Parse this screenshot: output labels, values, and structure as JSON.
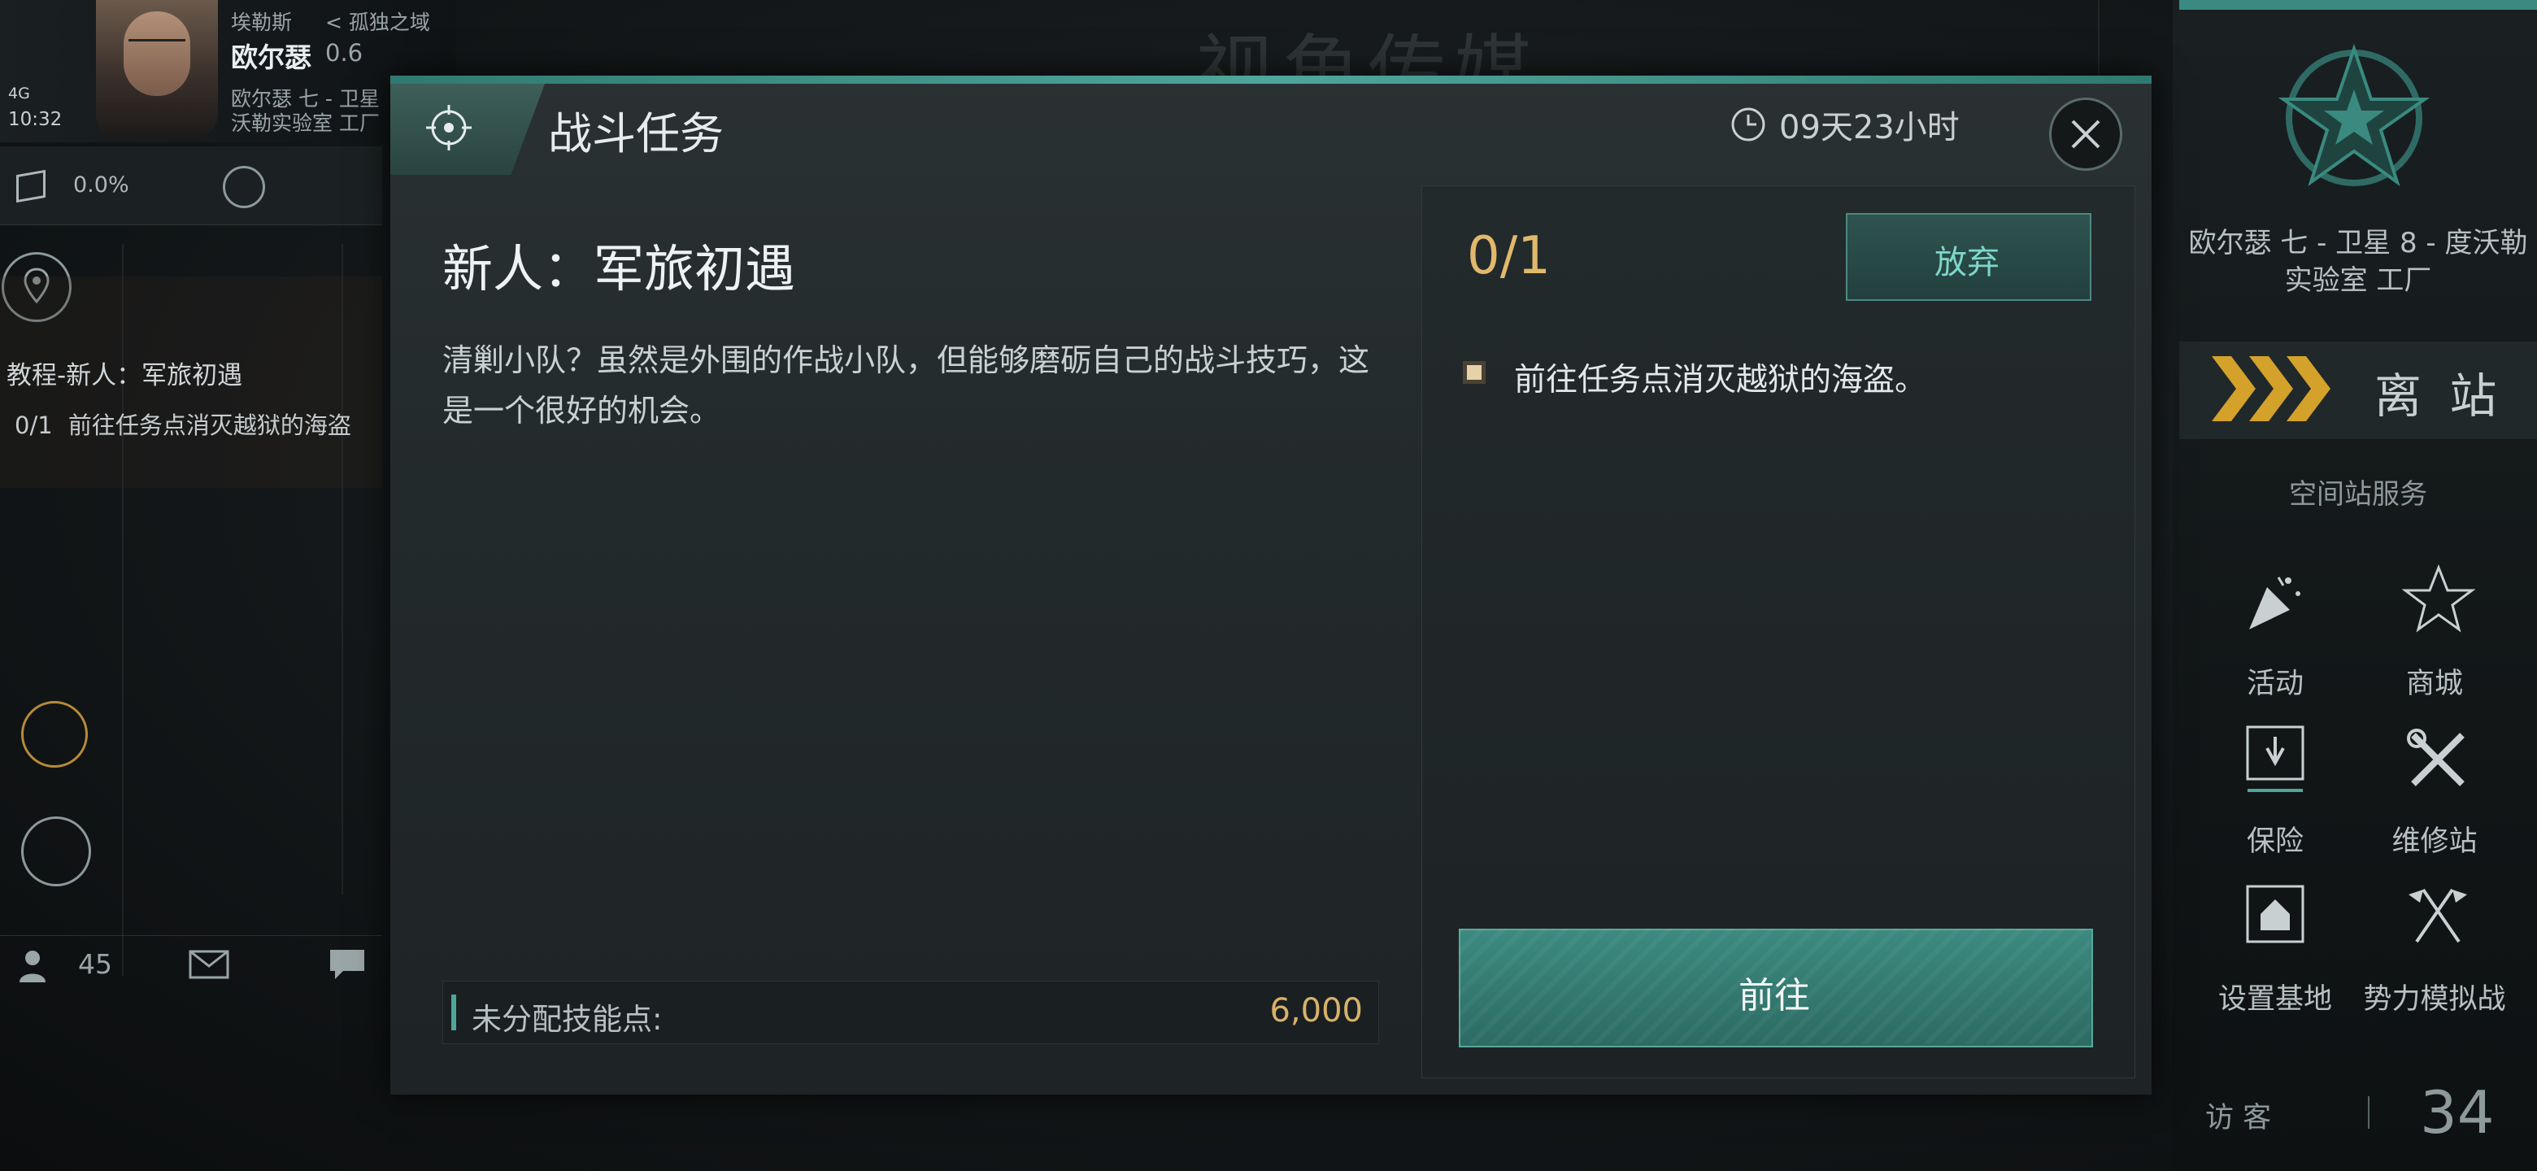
{
  "hud": {
    "region": "埃勒斯",
    "area": "< 孤独之域",
    "system": "欧尔瑟",
    "security": "0.6",
    "station_line1": "欧尔瑟 七 - 卫星",
    "station_line2": "沃勒实验室 工厂",
    "network": "4G",
    "time": "10:32",
    "cargo_pct": "0.0%",
    "tutorial_title": "教程-新人：军旅初遇",
    "tutorial_progress": "0/1",
    "tutorial_task": "前往任务点消灭越狱的海盗",
    "online_count": "45"
  },
  "background": {
    "title": "视角传媒"
  },
  "right_panel": {
    "location": "欧尔瑟 七 - 卫星 8 - 度沃勒实验室 工厂",
    "depart_label": "离 站",
    "services_title": "空间站服务",
    "services": [
      {
        "label": "活动",
        "icon": "party-popper-icon"
      },
      {
        "label": "商城",
        "icon": "shop-star-icon"
      },
      {
        "label": "保险",
        "icon": "insurance-shield-icon"
      },
      {
        "label": "维修站",
        "icon": "repair-tools-icon"
      },
      {
        "label": "设置基地",
        "icon": "base-icon"
      },
      {
        "label": "势力模拟战",
        "icon": "crossed-flags-icon"
      }
    ],
    "visitor_label": "访 客",
    "visitor_count": "34"
  },
  "modal": {
    "title": "战斗任务",
    "timer": "09天23小时",
    "mission_name": "新人：军旅初遇",
    "description": "清剿小队？虽然是外围的作战小队，但能够磨砺自己的战斗技巧，这是一个很好的机会。",
    "skill_points_label": "未分配技能点:",
    "skill_points_value": "6,000",
    "progress": "0/1",
    "abandon_label": "放弃",
    "objective": "前往任务点消灭越狱的海盗。",
    "go_label": "前往"
  },
  "colors": {
    "accent_teal": "#4fa69b",
    "gold": "#e1b96b",
    "modal_bg": "#252c2e"
  }
}
